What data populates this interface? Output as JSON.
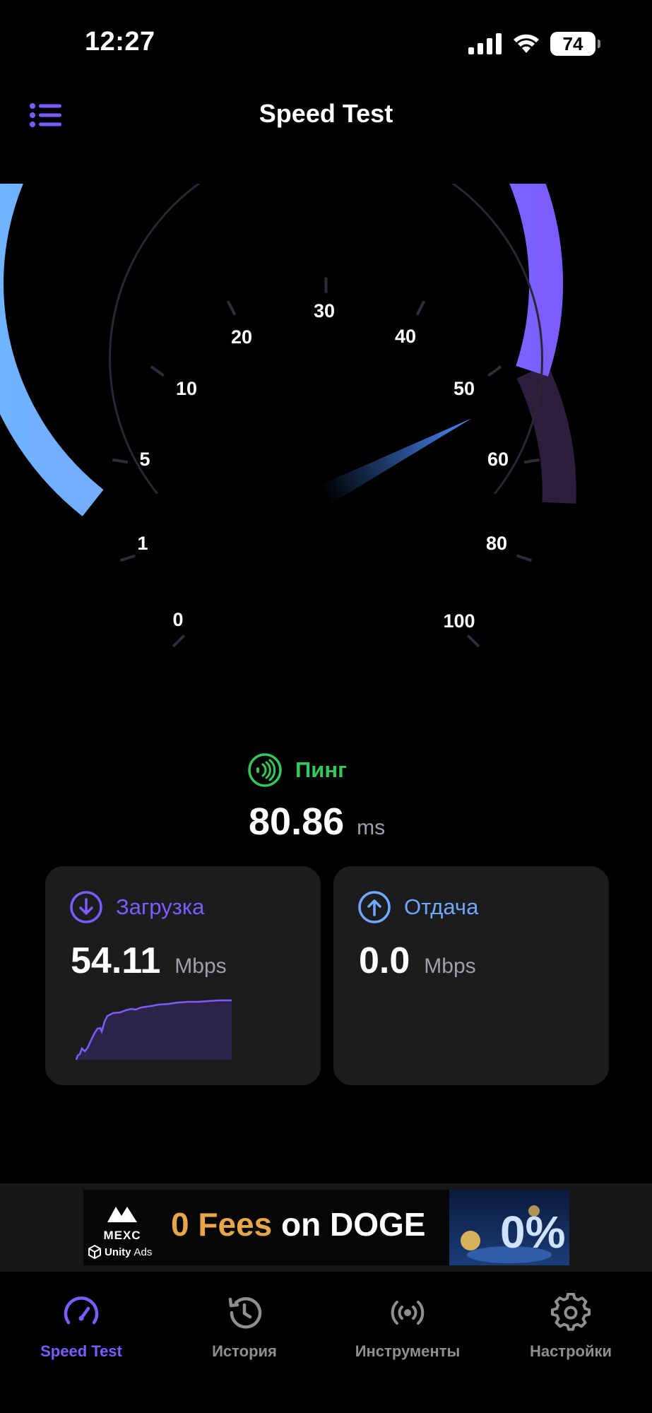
{
  "status_bar": {
    "time": "12:27",
    "battery": "74"
  },
  "header": {
    "title": "Speed Test"
  },
  "gauge": {
    "scale_labels": [
      "0",
      "1",
      "5",
      "10",
      "20",
      "30",
      "40",
      "50",
      "60",
      "80",
      "100"
    ],
    "needle_value_mbps": 54.11
  },
  "ping": {
    "label": "Пинг",
    "value": "80.86",
    "unit": "ms"
  },
  "download": {
    "label": "Загрузка",
    "value": "54.11",
    "unit": "Mbps"
  },
  "upload": {
    "label": "Отдача",
    "value": "0.0",
    "unit": "Mbps"
  },
  "ad": {
    "brand": "MEXC",
    "headline_highlight": "0 Fees",
    "headline_rest": " on DOGE",
    "network_unity": "Unity",
    "network_ads": "Ads",
    "badge": "0%"
  },
  "tabs": [
    {
      "label": "Speed Test",
      "icon": "speedometer-icon"
    },
    {
      "label": "История",
      "icon": "history-icon"
    },
    {
      "label": "Инструменты",
      "icon": "tools-icon"
    },
    {
      "label": "Настройки",
      "icon": "settings-icon"
    }
  ],
  "colors": {
    "accent": "#7c5cff",
    "gauge_start": "#6fb4ff",
    "gauge_end": "#7b5cff",
    "gauge_remaining": "#2b1f3d",
    "ping_green": "#34c759",
    "upload_blue": "#6fa8ff",
    "card_bg": "#1c1c1e"
  }
}
